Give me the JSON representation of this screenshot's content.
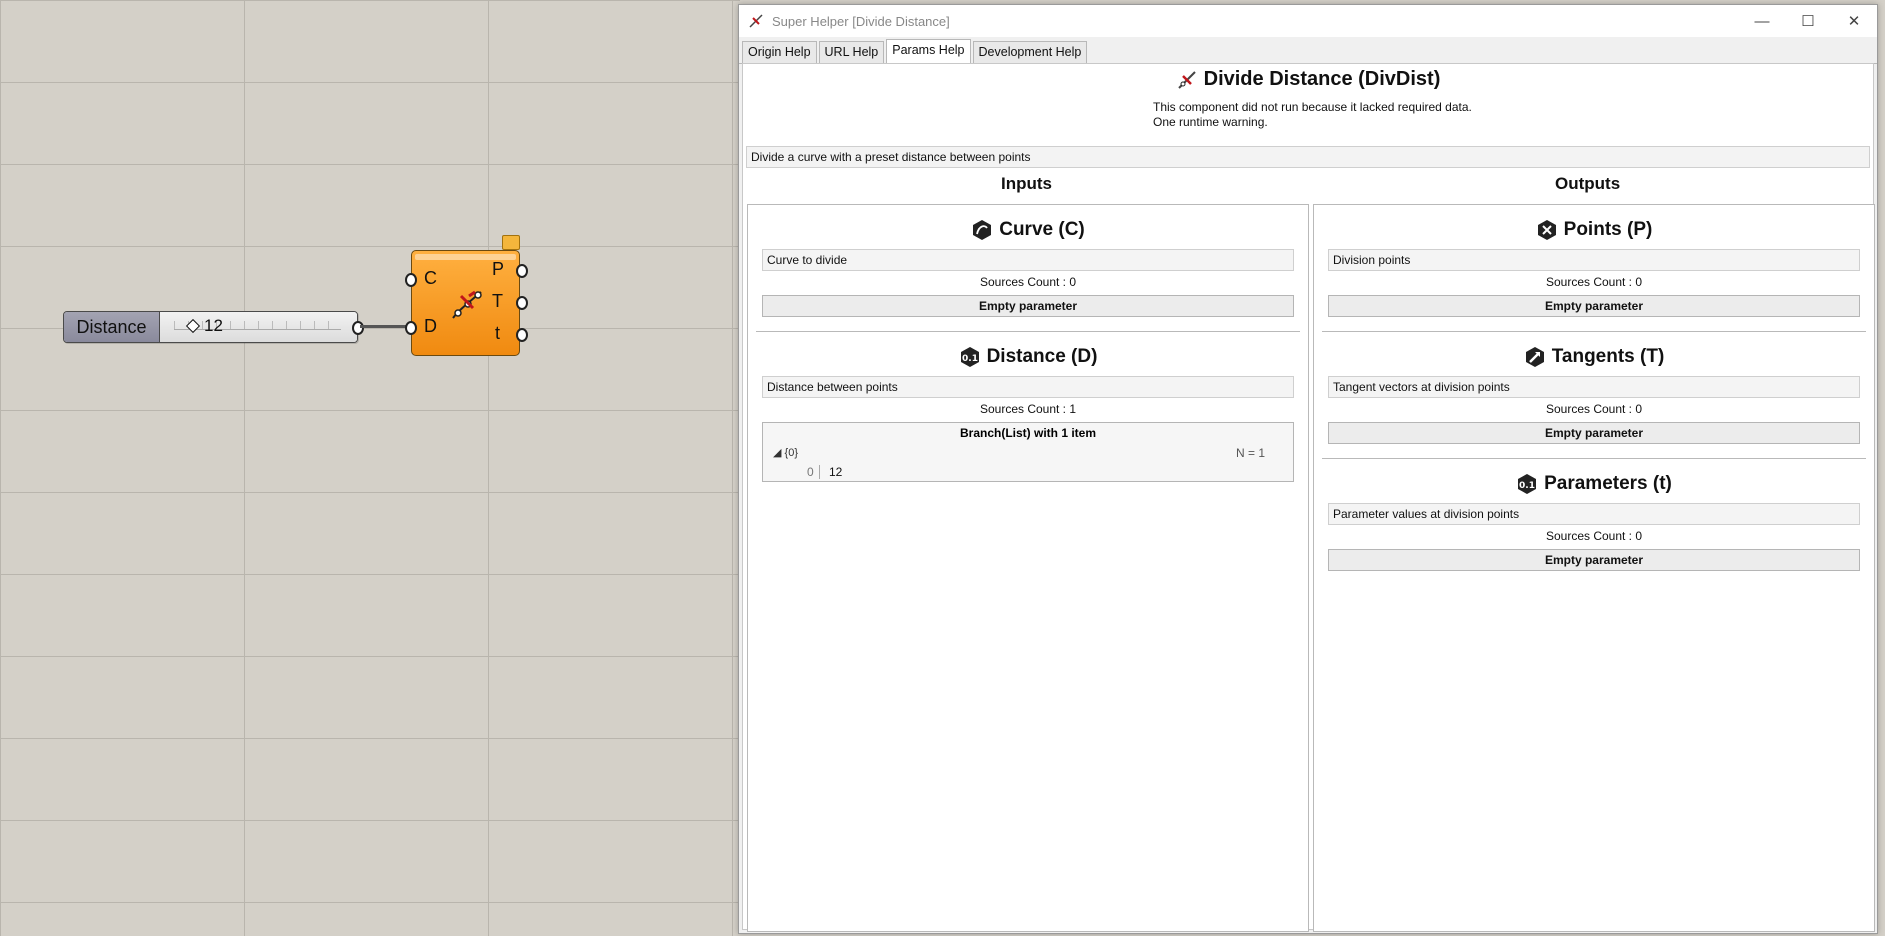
{
  "canvas": {
    "slider": {
      "name": "Distance",
      "value": "12"
    },
    "component": {
      "inputs": [
        "C",
        "D"
      ],
      "outputs": [
        "P",
        "T",
        "t"
      ]
    }
  },
  "window": {
    "title": "Super Helper [Divide Distance]",
    "controls": {
      "minimize": "—",
      "maximize": "☐",
      "close": "✕"
    },
    "tabs": [
      {
        "label": "Origin Help",
        "active": false
      },
      {
        "label": "URL Help",
        "active": false
      },
      {
        "label": "Params Help",
        "active": true
      },
      {
        "label": "Development Help",
        "active": false
      }
    ],
    "header": {
      "title": "Divide Distance (DivDist)",
      "note1": "This component did not run because it lacked required data.",
      "note2": "One runtime warning."
    },
    "description": "Divide a curve with a preset distance between points",
    "inputs_heading": "Inputs",
    "outputs_heading": "Outputs",
    "inputs": [
      {
        "title": "Curve (C)",
        "icon": "curve-param-icon",
        "desc": "Curve to divide",
        "sources": "Sources Count : 0",
        "empty": "Empty parameter"
      },
      {
        "title": "Distance (D)",
        "icon": "number-param-icon",
        "desc": "Distance between points",
        "sources": "Sources Count : 1",
        "tree": {
          "header": "Branch(List) with 1 item",
          "branch": "{0}",
          "count": "N = 1",
          "index": "0",
          "value": "12"
        }
      }
    ],
    "outputs": [
      {
        "title": "Points (P)",
        "icon": "point-param-icon",
        "desc": "Division points",
        "sources": "Sources Count : 0",
        "empty": "Empty parameter"
      },
      {
        "title": "Tangents (T)",
        "icon": "vector-param-icon",
        "desc": "Tangent vectors at division points",
        "sources": "Sources Count : 0",
        "empty": "Empty parameter"
      },
      {
        "title": "Parameters (t)",
        "icon": "number-param-icon",
        "desc": "Parameter values at division points",
        "sources": "Sources Count : 0",
        "empty": "Empty parameter"
      }
    ]
  },
  "colors": {
    "canvas_bg": "#d4d0c8",
    "component_orange": "#f49a1c",
    "window_bg": "#f0f0f0"
  }
}
